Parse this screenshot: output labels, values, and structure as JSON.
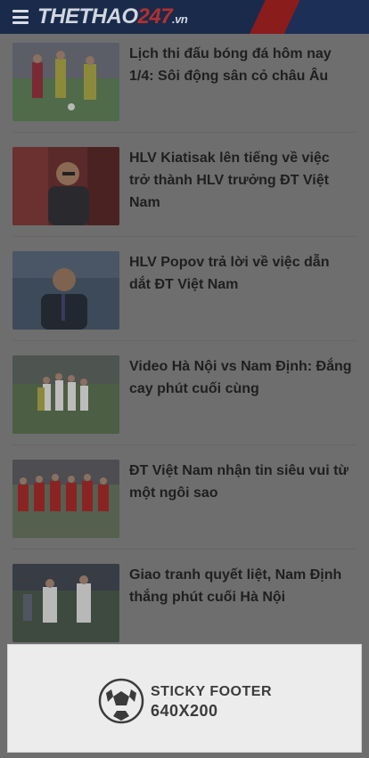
{
  "header": {
    "logo_main": "THETHAO",
    "logo_num": "247",
    "logo_tld": ".vn",
    "menu_icon": "hamburger-menu-icon"
  },
  "articles": [
    {
      "title": "Lịch thi đấu bóng đá hôm nay 1/4: Sôi động sân cỏ châu Âu"
    },
    {
      "title": "HLV Kiatisak lên tiếng về việc trở thành HLV trưởng ĐT Việt Nam"
    },
    {
      "title": "HLV Popov trả lời về việc dẫn dắt ĐT Việt Nam"
    },
    {
      "title": "Video Hà Nội vs Nam Định: Đắng cay phút cuối cùng"
    },
    {
      "title": "ĐT Việt Nam nhận tin siêu vui từ một ngôi sao"
    },
    {
      "title": "Giao tranh quyết liệt, Nam Định thắng phút cuối Hà Nội"
    }
  ],
  "footer_ad": {
    "line1": "STICKY FOOTER",
    "line2": "640X200",
    "icon": "soccer-ball-icon"
  },
  "colors": {
    "header_bg": "#1a2a4a",
    "accent_red": "#b23030",
    "overlay": "#6e6e6e"
  }
}
